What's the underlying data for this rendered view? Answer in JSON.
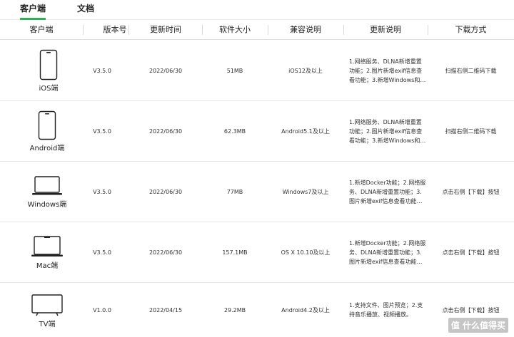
{
  "tabs": {
    "active": "客户端",
    "second": "文档"
  },
  "columns": [
    "客户端",
    "版本号",
    "更新时间",
    "软件大小",
    "兼容说明",
    "更新说明",
    "下载方式"
  ],
  "rows": [
    {
      "device": "iOS端",
      "icon": "phone-icon",
      "version": "V3.5.0",
      "date": "2022/06/30",
      "size": "51MB",
      "compat": "iOS12及以上",
      "notes": "1.网络服务、DLNA新增重置功能；2.图片新增exif信息查看功能；3.新增Windows和…",
      "download": "扫描右侧二维码下载"
    },
    {
      "device": "Android端",
      "icon": "phone-icon",
      "version": "V3.5.0",
      "date": "2022/06/30",
      "size": "62.3MB",
      "compat": "Android5.1及以上",
      "notes": "1.网络服务、DLNA新增重置功能；2.图片新增exif信息查看功能；3.新增Windows和…",
      "download": "扫描右侧二维码下载"
    },
    {
      "device": "Windows端",
      "icon": "laptop-icon",
      "version": "V3.5.0",
      "date": "2022/06/30",
      "size": "77MB",
      "compat": "Windows7及以上",
      "notes": "1.新增Docker功能；2.网络服务、DLNA新增重置功能；3.图片新增exif信息查看功能…",
      "download": "点击右侧【下载】按钮"
    },
    {
      "device": "Mac端",
      "icon": "macbook-icon",
      "version": "V3.5.0",
      "date": "2022/06/30",
      "size": "157.1MB",
      "compat": "OS X 10.10及以上",
      "notes": "1.新增Docker功能；2.网络服务、DLNA新增重置功能；3.图片新增exif信息查看功能…",
      "download": "点击右侧【下载】按钮"
    },
    {
      "device": "TV端",
      "icon": "tv-icon",
      "version": "V1.0.0",
      "date": "2022/04/15",
      "size": "29.2MB",
      "compat": "Android4.2及以上",
      "notes": "1.支持文件、图片预览；2.支持音乐播放、视频播放。",
      "download": "点击右侧【下载】按钮"
    }
  ],
  "watermark": "值 什么值得买",
  "colors": {
    "accent": "#2bb24c"
  }
}
